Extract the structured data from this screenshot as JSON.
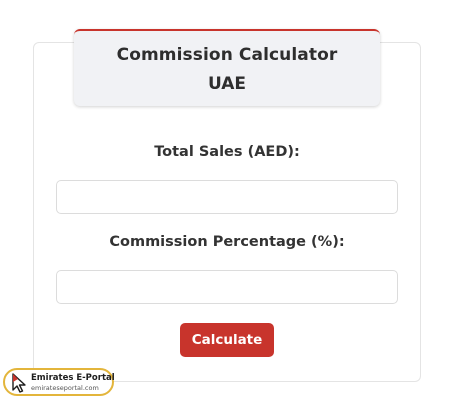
{
  "header": {
    "title": "Commission Calculator",
    "subtitle": "UAE"
  },
  "form": {
    "total_sales_label": "Total Sales (AED):",
    "total_sales_value": "",
    "commission_label": "Commission Percentage (%):",
    "commission_value": "",
    "calculate_label": "Calculate"
  },
  "watermark": {
    "name": "Emirates E-Portal",
    "url": "emirateseportal.com",
    "icon": "cursor-arrow-icon"
  },
  "colors": {
    "accent": "#c8342c",
    "header_bg": "#f1f2f5",
    "watermark_border": "#e3b53b"
  }
}
